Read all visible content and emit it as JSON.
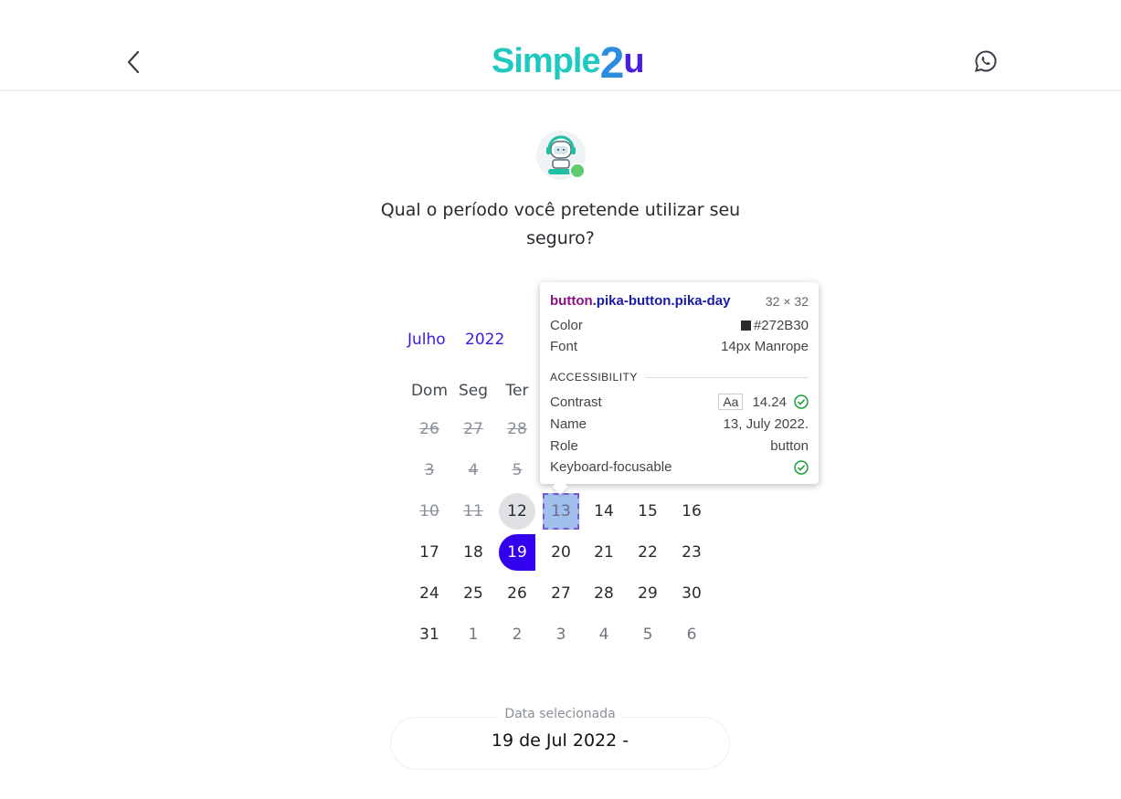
{
  "header": {
    "logo_part1": "Simple",
    "logo_part2": "2",
    "logo_part3": "u",
    "back_icon": "chevron-left-icon",
    "whatsapp_icon": "whatsapp-icon"
  },
  "question": "Qual o período você pretende utilizar seu seguro?",
  "calendar": {
    "month": "Julho",
    "year": "2022",
    "weekdays": [
      "Dom",
      "Seg",
      "Ter"
    ],
    "weeks": [
      [
        {
          "label": "26",
          "state": "disabled"
        },
        {
          "label": "27",
          "state": "disabled"
        },
        {
          "label": "28",
          "state": "disabled"
        }
      ],
      [
        {
          "label": "3",
          "state": "disabled"
        },
        {
          "label": "4",
          "state": "disabled"
        },
        {
          "label": "5",
          "state": "disabled"
        }
      ],
      [
        {
          "label": "10",
          "state": "disabled"
        },
        {
          "label": "11",
          "state": "disabled"
        },
        {
          "label": "12",
          "state": "today"
        },
        {
          "label": "13",
          "state": "hover-target"
        },
        {
          "label": "14",
          "state": ""
        },
        {
          "label": "15",
          "state": ""
        },
        {
          "label": "16",
          "state": ""
        }
      ],
      [
        {
          "label": "17",
          "state": ""
        },
        {
          "label": "18",
          "state": ""
        },
        {
          "label": "19",
          "state": "selected"
        },
        {
          "label": "20",
          "state": ""
        },
        {
          "label": "21",
          "state": ""
        },
        {
          "label": "22",
          "state": ""
        },
        {
          "label": "23",
          "state": ""
        }
      ],
      [
        {
          "label": "24",
          "state": ""
        },
        {
          "label": "25",
          "state": ""
        },
        {
          "label": "26",
          "state": ""
        },
        {
          "label": "27",
          "state": ""
        },
        {
          "label": "28",
          "state": ""
        },
        {
          "label": "29",
          "state": ""
        },
        {
          "label": "30",
          "state": ""
        }
      ],
      [
        {
          "label": "31",
          "state": ""
        },
        {
          "label": "1",
          "state": "outside"
        },
        {
          "label": "2",
          "state": "outside"
        },
        {
          "label": "3",
          "state": "outside"
        },
        {
          "label": "4",
          "state": "outside"
        },
        {
          "label": "5",
          "state": "outside"
        },
        {
          "label": "6",
          "state": "outside"
        }
      ]
    ]
  },
  "inspector": {
    "selector_tag": "button",
    "selector_classes": ".pika-button.pika-day",
    "dimensions": "32 × 32",
    "color_label": "Color",
    "color_value": "#272B30",
    "font_label": "Font",
    "font_value": "14px Manrope",
    "section": "ACCESSIBILITY",
    "contrast_label": "Contrast",
    "contrast_aa": "Aa",
    "contrast_value": "14.24",
    "name_label": "Name",
    "name_value": "13, July 2022.",
    "role_label": "Role",
    "role_value": "button",
    "keyboard_label": "Keyboard-focusable"
  },
  "selection": {
    "label": "Data selecionada",
    "value": "19 de Jul 2022 -"
  },
  "colors": {
    "accent": "#3300ee",
    "logo_teal": "#1fc9c0",
    "logo_blue": "#2b8ce0",
    "online": "#5ecb6e",
    "pass_green": "#1a9e3a"
  }
}
